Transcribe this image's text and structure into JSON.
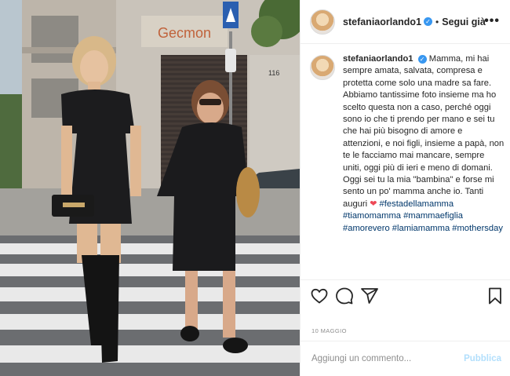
{
  "header": {
    "username": "stefaniaorlando1",
    "separator": "•",
    "follow_label": "Segui già",
    "more_label": "•••"
  },
  "photo": {
    "shop_sign": "Gecmon",
    "street_number": "116"
  },
  "caption": {
    "username": "stefaniaorlando1",
    "text": "Mamma, mi hai sempre amata, salvata, compresa e protetta come solo una madre sa fare. Abbiamo tantissime foto insieme ma ho scelto questa non a caso, perché oggi sono io che ti prendo per mano e sei tu che hai più bisogno di amore e attenzioni, e noi figli, insieme a papà, non te le facciamo mai mancare, sempre uniti, oggi più di ieri e meno di domani. Oggi sei tu la mia \"bambina\" e forse mi sento un po' mamma anche io. Tanti auguri",
    "heart": "❤",
    "hashtags": "#festadellamamma #tiamomamma #mammaefiglia #amorevero #lamiamamma #mothersday"
  },
  "date": "10 MAGGIO",
  "comment_box": {
    "placeholder": "Aggiungi un commento...",
    "publish_label": "Pubblica"
  }
}
